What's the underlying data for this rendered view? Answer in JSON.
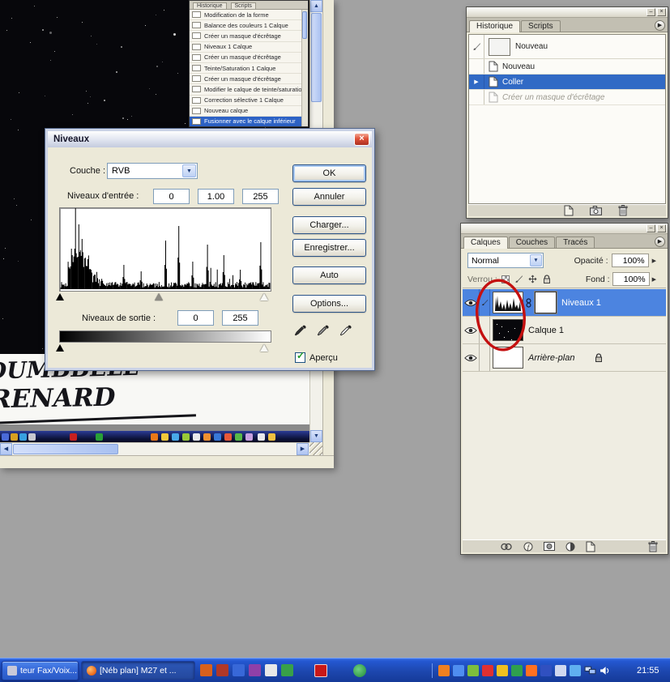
{
  "document": {
    "caption_line1": "DUMBBELL\"",
    "caption_line2": "RENARD"
  },
  "floating_history": {
    "tabs": [
      "Historique",
      "Scripts"
    ],
    "selected_index": 10,
    "items": [
      "Modification de la forme",
      "Balance des couleurs 1 Calque",
      "Créer un masque d'écrêtage",
      "Niveaux 1 Calque",
      "Créer un masque d'écrêtage",
      "Teinte/Saturation 1 Calque",
      "Créer un masque d'écrêtage",
      "Modifier le calque de teinte/saturation",
      "Correction sélective 1 Calque",
      "Nouveau calque",
      "Fusionner avec le calque inférieur"
    ]
  },
  "levels": {
    "title": "Niveaux",
    "channel_label": "Couche :",
    "channel_value": "RVB",
    "input_label": "Niveaux d'entrée :",
    "input_low": "0",
    "input_gamma": "1.00",
    "input_high": "255",
    "output_label": "Niveaux de sortie :",
    "output_low": "0",
    "output_high": "255",
    "ok": "OK",
    "cancel": "Annuler",
    "load": "Charger...",
    "save": "Enregistrer...",
    "auto": "Auto",
    "options": "Options...",
    "preview": "Aperçu"
  },
  "history_panel": {
    "tabs": [
      "Historique",
      "Scripts"
    ],
    "snapshot_label": "Nouveau",
    "items": [
      {
        "label": "Nouveau",
        "state": "normal"
      },
      {
        "label": "Coller",
        "state": "selected"
      },
      {
        "label": "Créer un masque d'écrêtage",
        "state": "undone"
      }
    ]
  },
  "layers_panel": {
    "tabs": [
      "Calques",
      "Couches",
      "Tracés"
    ],
    "blend_mode": "Normal",
    "opacity_label": "Opacité :",
    "opacity_value": "100%",
    "lock_label": "Verrou :",
    "fill_label": "Fond :",
    "fill_value": "100%",
    "layers": [
      {
        "name": "Niveaux 1"
      },
      {
        "name": "Calque 1"
      },
      {
        "name": "Arrière-plan"
      }
    ]
  },
  "taskbar": {
    "task1_label": "teur Fax/Voix...",
    "task2_label": "[Néb plan] M27 et ...",
    "clock": "21:55"
  },
  "colors": {
    "selection_blue": "#316AC5",
    "layer_selected_blue": "#4C84E0",
    "annotation_red": "#C41010"
  },
  "decor": {
    "histogram_spikes": [
      [
        0.05,
        0.5
      ],
      [
        0.07,
        1.0
      ],
      [
        0.085,
        0.8
      ],
      [
        0.1,
        0.62
      ],
      [
        0.115,
        0.38
      ],
      [
        0.145,
        0.24
      ],
      [
        0.3,
        0.3
      ],
      [
        0.385,
        0.22
      ],
      [
        0.5,
        0.6
      ],
      [
        0.565,
        0.78
      ],
      [
        0.63,
        0.34
      ],
      [
        0.7,
        0.55
      ],
      [
        0.78,
        0.42
      ],
      [
        0.86,
        0.24
      ],
      [
        0.955,
        0.58
      ]
    ],
    "quicklaunch_colors": [
      "#D8601C",
      "#B03828",
      "#3868D8",
      "#9040A8",
      "#E8E8E8",
      "#38A048"
    ],
    "tray_colors": [
      "#F08020",
      "#4F8EF0",
      "#7DBE3C",
      "#E03030",
      "#F0C020",
      "#2FA04E",
      "#FF7020",
      "#3050C0",
      "#D0D8F0",
      "#60B0F0"
    ],
    "inner_taskbar_icons": [
      [
        2,
        "#4A6AD8"
      ],
      [
        13,
        "#D8A020"
      ],
      [
        24,
        "#38A0E0"
      ],
      [
        35,
        "#C8C8D0"
      ],
      [
        86,
        "#C82020"
      ],
      [
        118,
        "#28A038"
      ],
      [
        186,
        "#E87818"
      ],
      [
        199,
        "#F0C83A"
      ],
      [
        212,
        "#48A8E8"
      ],
      [
        225,
        "#98C838"
      ],
      [
        238,
        "#E8E8EC"
      ],
      [
        251,
        "#F09030"
      ],
      [
        264,
        "#3878D8"
      ],
      [
        277,
        "#E85838"
      ],
      [
        290,
        "#58B848"
      ],
      [
        303,
        "#C8A0E0"
      ],
      [
        318,
        "#E8E8EC"
      ],
      [
        331,
        "#F0C040"
      ]
    ]
  }
}
